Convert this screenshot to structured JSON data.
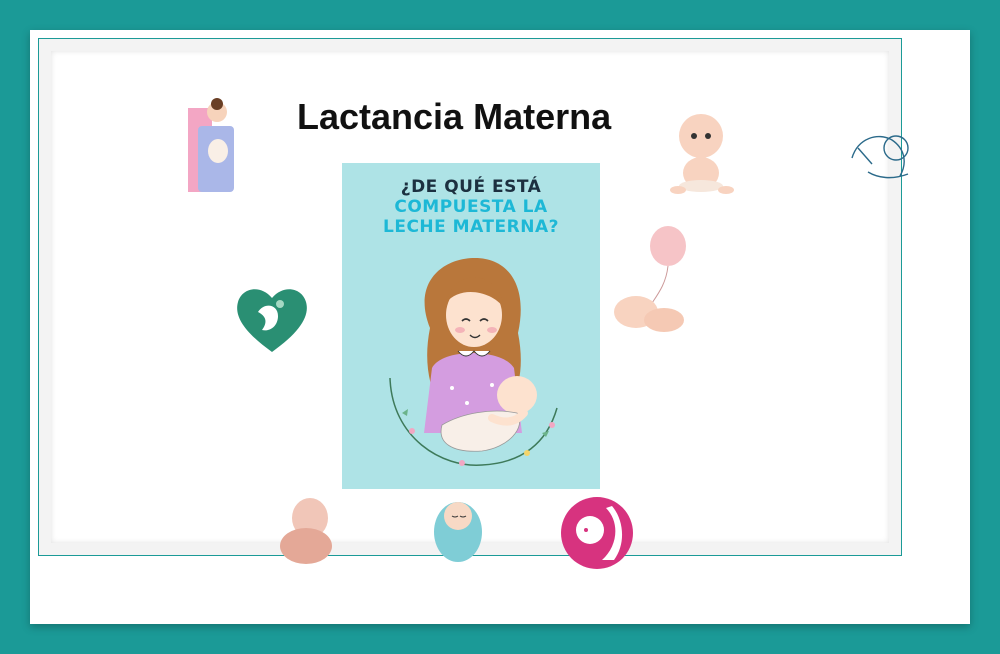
{
  "title": "Lactancia Materna",
  "poster": {
    "line1": "¿DE QUÉ ESTÁ",
    "line2": "COMPUESTA LA",
    "line3": "LECHE MATERNA?"
  },
  "colors": {
    "background": "#1b9a97",
    "frame": "#ffffff",
    "poster_bg": "#aee3e6",
    "poster_heading_dark": "#1c3040",
    "poster_heading_accent": "#1db8d6"
  },
  "stickers": [
    "breastfeeding-mother-icon",
    "sitting-baby-icon",
    "nursing-line-art-icon",
    "mother-baby-heart-icon",
    "sleeping-baby-balloon-icon",
    "baby-hug-icon",
    "swaddled-baby-icon",
    "pink-circle-breastfeeding-icon"
  ]
}
